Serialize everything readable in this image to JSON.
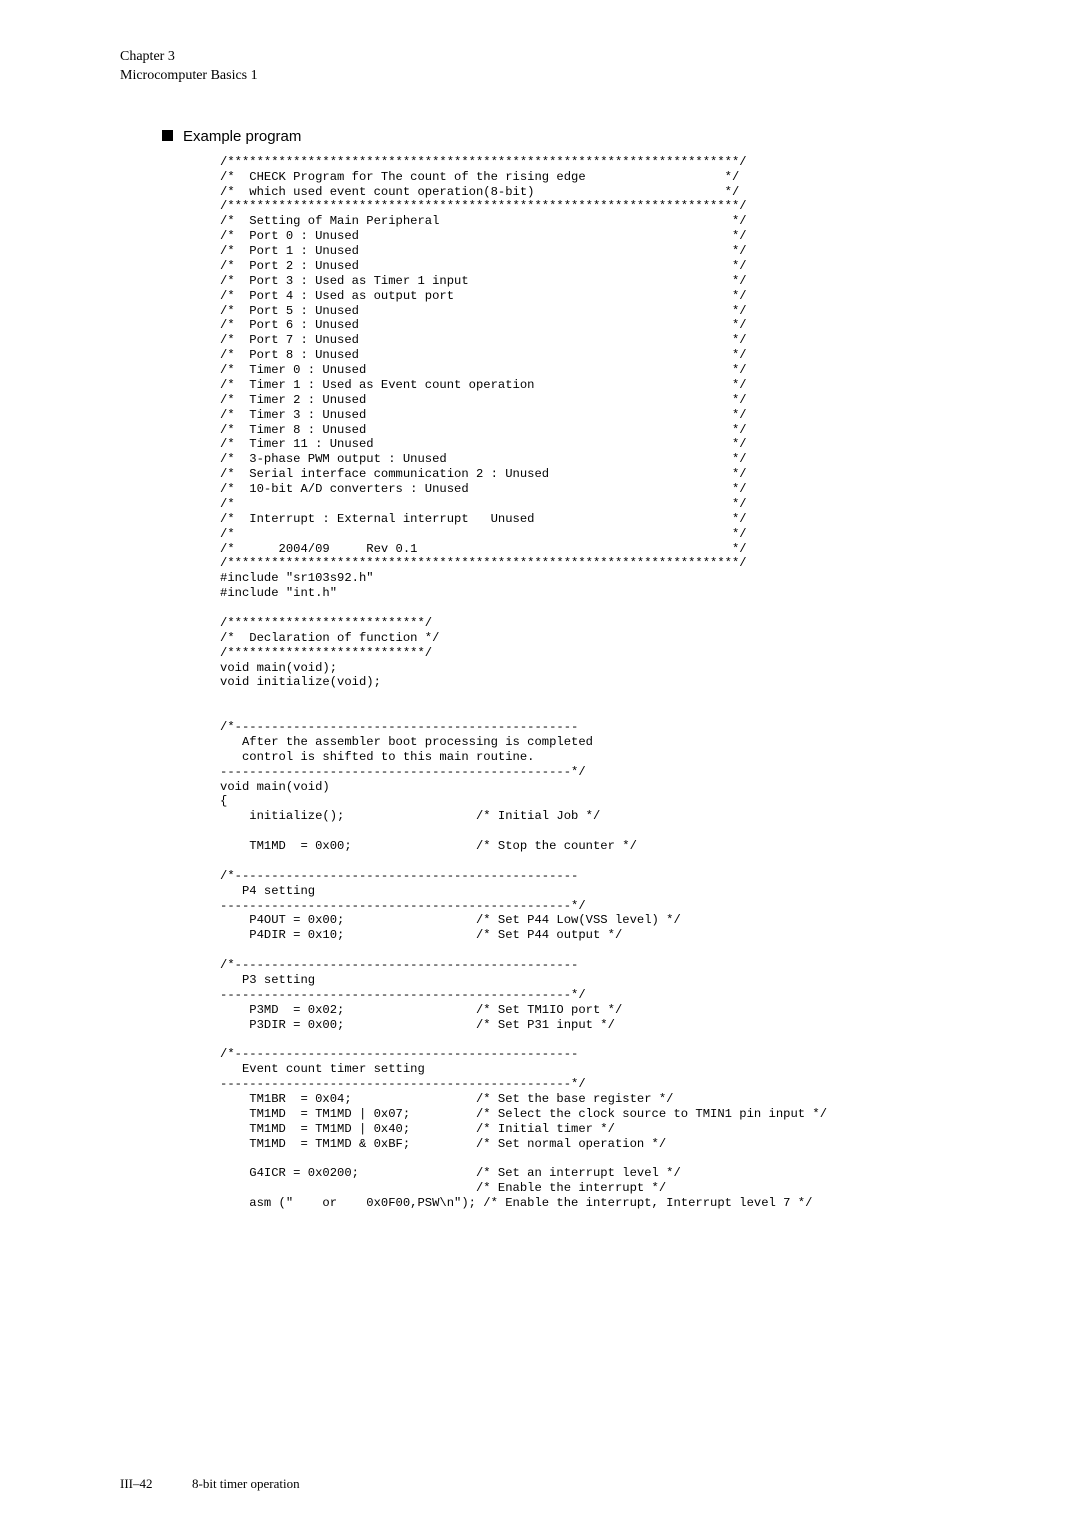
{
  "header": {
    "chapter": "Chapter 3",
    "subtitle": "Microcomputer Basics 1"
  },
  "section": {
    "title": "Example program"
  },
  "code": "/**********************************************************************/\n/*  CHECK Program for The count of the rising edge                   */\n/*  which used event count operation(8-bit)                          */\n/**********************************************************************/\n/*  Setting of Main Peripheral                                        */\n/*  Port 0 : Unused                                                   */\n/*  Port 1 : Unused                                                   */\n/*  Port 2 : Unused                                                   */\n/*  Port 3 : Used as Timer 1 input                                    */\n/*  Port 4 : Used as output port                                      */\n/*  Port 5 : Unused                                                   */\n/*  Port 6 : Unused                                                   */\n/*  Port 7 : Unused                                                   */\n/*  Port 8 : Unused                                                   */\n/*  Timer 0 : Unused                                                  */\n/*  Timer 1 : Used as Event count operation                           */\n/*  Timer 2 : Unused                                                  */\n/*  Timer 3 : Unused                                                  */\n/*  Timer 8 : Unused                                                  */\n/*  Timer 11 : Unused                                                 */\n/*  3-phase PWM output : Unused                                       */\n/*  Serial interface communication 2 : Unused                         */\n/*  10-bit A/D converters : Unused                                    */\n/*                                                                    */\n/*  Interrupt : External interrupt   Unused                           */\n/*                                                                    */\n/*      2004/09     Rev 0.1                                           */\n/**********************************************************************/\n#include \"sr103s92.h\"\n#include \"int.h\"\n\n/***************************/\n/*  Declaration of function */\n/***************************/\nvoid main(void);\nvoid initialize(void);\n\n\n/*-----------------------------------------------\n   After the assembler boot processing is completed\n   control is shifted to this main routine.\n------------------------------------------------*/\nvoid main(void)\n{\n    initialize();                  /* Initial Job */\n\n    TM1MD  = 0x00;                 /* Stop the counter */\n\n/*-----------------------------------------------\n   P4 setting\n------------------------------------------------*/\n    P4OUT = 0x00;                  /* Set P44 Low(VSS level) */\n    P4DIR = 0x10;                  /* Set P44 output */\n\n/*-----------------------------------------------\n   P3 setting\n------------------------------------------------*/\n    P3MD  = 0x02;                  /* Set TM1IO port */\n    P3DIR = 0x00;                  /* Set P31 input */\n\n/*-----------------------------------------------\n   Event count timer setting\n------------------------------------------------*/\n    TM1BR  = 0x04;                 /* Set the base register */\n    TM1MD  = TM1MD | 0x07;         /* Select the clock source to TMIN1 pin input */\n    TM1MD  = TM1MD | 0x40;         /* Initial timer */\n    TM1MD  = TM1MD & 0xBF;         /* Set normal operation */\n\n    G4ICR = 0x0200;                /* Set an interrupt level */\n                                   /* Enable the interrupt */\n    asm (\"    or    0x0F00,PSW\\n\"); /* Enable the interrupt, Interrupt level 7 */",
  "footer": {
    "page": "III–42",
    "title": "8-bit timer operation"
  }
}
